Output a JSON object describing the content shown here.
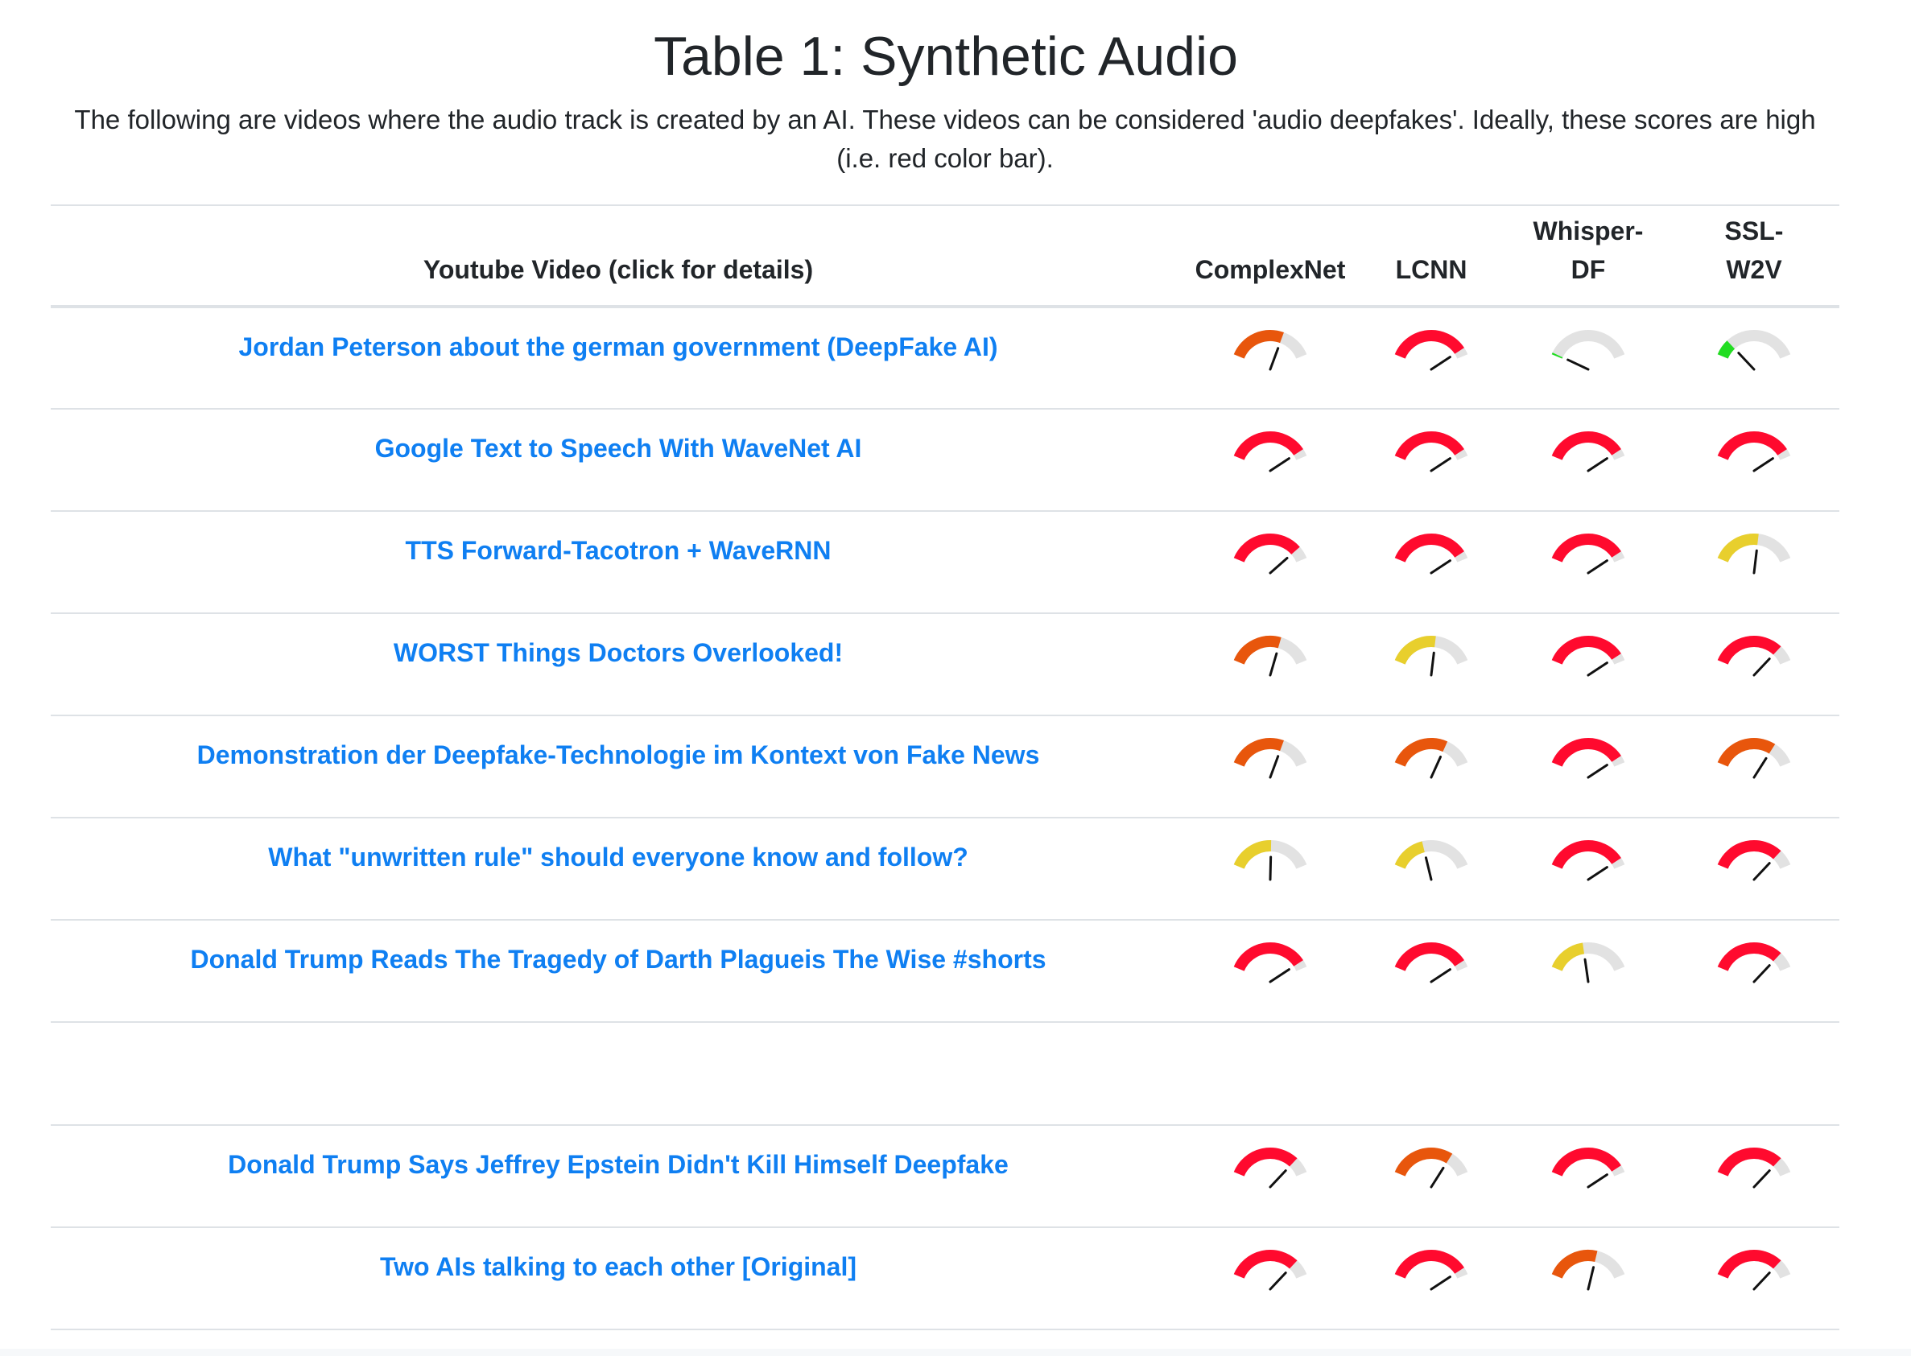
{
  "title": "Table 1: Synthetic Audio",
  "description": "The following are videos where the audio track is created by an AI. These videos can be considered 'audio deepfakes'. Ideally, these scores are high (i.e. red color bar).",
  "table": {
    "headers": {
      "video": "Youtube Video (click for details)",
      "complexnet": "ComplexNet",
      "lcnn": "LCNN",
      "whisper_df": "Whisper-DF",
      "ssl_w2v": "SSL-W2V"
    }
  },
  "gauge_colors": {
    "red": "#ff0a2e",
    "orange": "#e8560c",
    "yellow": "#e8cf2d",
    "green": "#22dd22",
    "track": "#e2e2e2",
    "needle": "#111111"
  },
  "rows": [
    {
      "title": "Jordan Peterson about the german government (DeepFake AI)",
      "scores": [
        {
          "value": 0.65,
          "color": "orange"
        },
        {
          "value": 0.92,
          "color": "red"
        },
        {
          "value": 0.02,
          "color": "green"
        },
        {
          "value": 0.18,
          "color": "green"
        }
      ]
    },
    {
      "title": "Google Text to Speech With WaveNet AI",
      "scores": [
        {
          "value": 0.92,
          "color": "red"
        },
        {
          "value": 0.92,
          "color": "red"
        },
        {
          "value": 0.92,
          "color": "red"
        },
        {
          "value": 0.92,
          "color": "red"
        }
      ]
    },
    {
      "title": "TTS Forward-Tacotron + WaveRNN",
      "scores": [
        {
          "value": 0.86,
          "color": "red"
        },
        {
          "value": 0.92,
          "color": "red"
        },
        {
          "value": 0.92,
          "color": "red"
        },
        {
          "value": 0.55,
          "color": "yellow"
        }
      ]
    },
    {
      "title": "WORST Things Doctors Overlooked!",
      "scores": [
        {
          "value": 0.62,
          "color": "orange"
        },
        {
          "value": 0.55,
          "color": "yellow"
        },
        {
          "value": 0.92,
          "color": "red"
        },
        {
          "value": 0.82,
          "color": "red"
        }
      ]
    },
    {
      "title": "Demonstration der Deepfake-Technologie im Kontext von Fake News",
      "scores": [
        {
          "value": 0.65,
          "color": "orange"
        },
        {
          "value": 0.68,
          "color": "orange"
        },
        {
          "value": 0.92,
          "color": "red"
        },
        {
          "value": 0.74,
          "color": "orange"
        }
      ]
    },
    {
      "title": "What \"unwritten rule\" should everyone know and follow?",
      "scores": [
        {
          "value": 0.51,
          "color": "yellow"
        },
        {
          "value": 0.4,
          "color": "yellow"
        },
        {
          "value": 0.92,
          "color": "red"
        },
        {
          "value": 0.82,
          "color": "red"
        }
      ]
    },
    {
      "title": "Donald Trump Reads The Tragedy of Darth Plagueis The Wise #shorts",
      "scores": [
        {
          "value": 0.92,
          "color": "red"
        },
        {
          "value": 0.92,
          "color": "red"
        },
        {
          "value": 0.44,
          "color": "yellow"
        },
        {
          "value": 0.82,
          "color": "red"
        }
      ]
    },
    {
      "spacer": true
    },
    {
      "title": "Donald Trump Says Jeffrey Epstein Didn't Kill Himself Deepfake",
      "scores": [
        {
          "value": 0.82,
          "color": "red"
        },
        {
          "value": 0.74,
          "color": "orange"
        },
        {
          "value": 0.92,
          "color": "red"
        },
        {
          "value": 0.82,
          "color": "red"
        }
      ]
    },
    {
      "title": "Two AIs talking to each other [Original]",
      "scores": [
        {
          "value": 0.82,
          "color": "red"
        },
        {
          "value": 0.92,
          "color": "red"
        },
        {
          "value": 0.6,
          "color": "orange"
        },
        {
          "value": 0.82,
          "color": "red"
        }
      ]
    }
  ]
}
